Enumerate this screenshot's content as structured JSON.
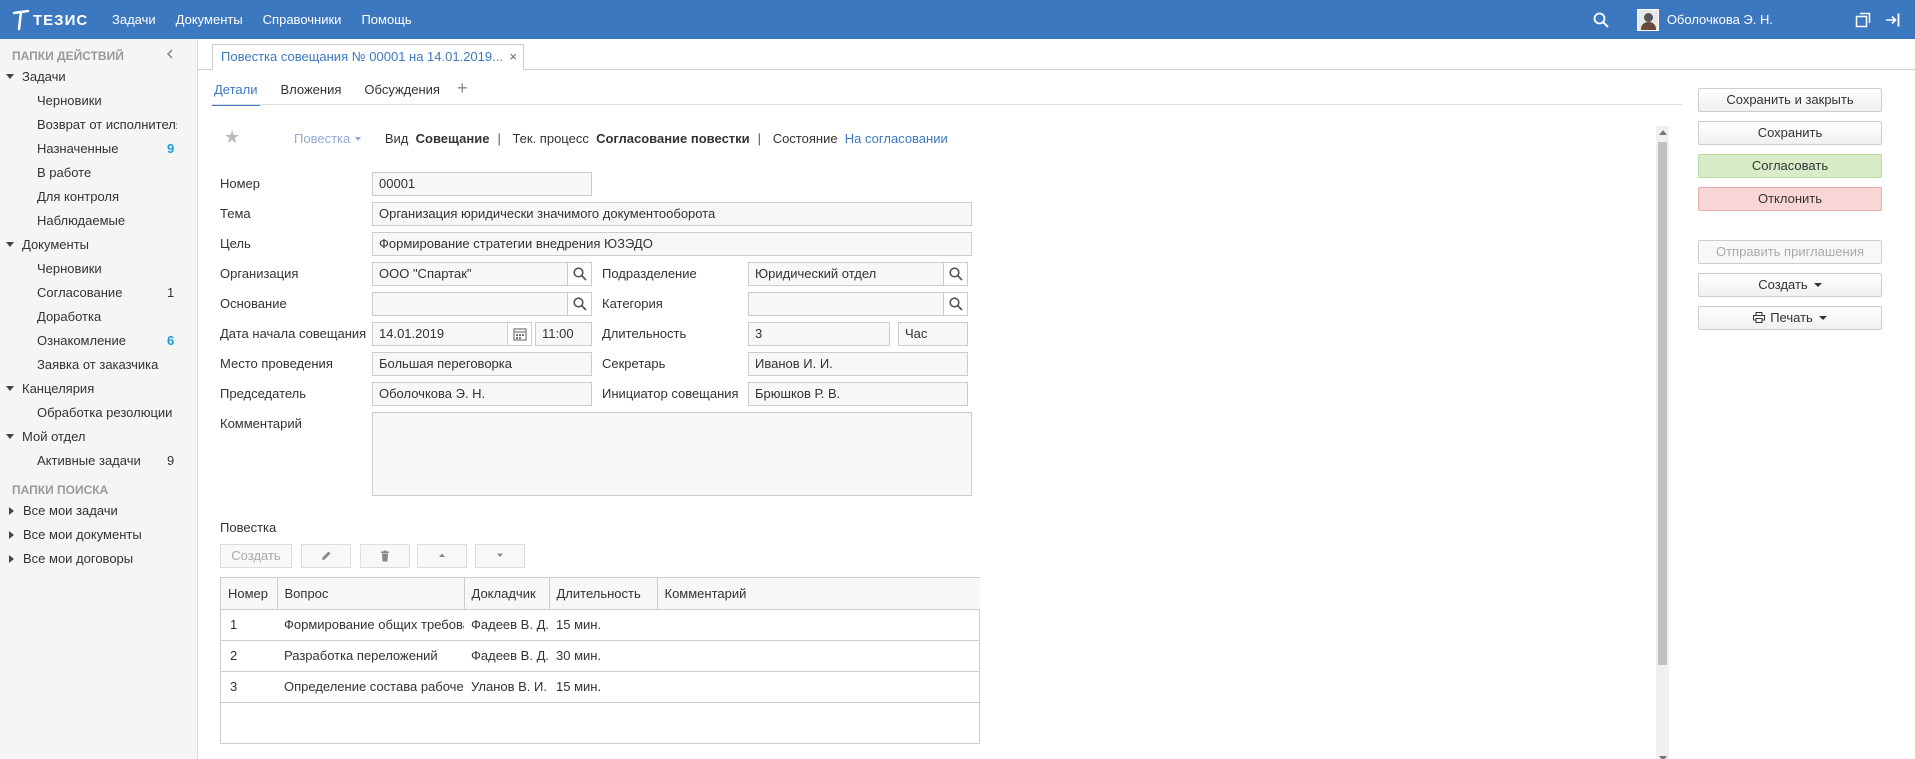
{
  "topbar": {
    "logo_text": "ТЕЗИС",
    "nav": [
      "Задачи",
      "Документы",
      "Справочники",
      "Помощь"
    ],
    "user_name": "Оболочкова Э. Н."
  },
  "sidebar": {
    "actions_title": "ПАПКИ ДЕЙСТВИЙ",
    "groups": [
      {
        "label": "Задачи",
        "children": [
          {
            "label": "Черновики",
            "count": ""
          },
          {
            "label": "Возврат от исполнителя",
            "count": ""
          },
          {
            "label": "Назначенные",
            "count": "9"
          },
          {
            "label": "В работе",
            "count": ""
          },
          {
            "label": "Для контроля",
            "count": ""
          },
          {
            "label": "Наблюдаемые",
            "count": ""
          }
        ]
      },
      {
        "label": "Документы",
        "children": [
          {
            "label": "Черновики",
            "count": ""
          },
          {
            "label": "Согласование",
            "count": "1"
          },
          {
            "label": "Доработка",
            "count": ""
          },
          {
            "label": "Ознакомление",
            "count": "6"
          },
          {
            "label": "Заявка от заказчика",
            "count": ""
          }
        ]
      },
      {
        "label": "Канцелярия",
        "children": [
          {
            "label": "Обработка резолюции",
            "count": ""
          }
        ]
      },
      {
        "label": "Мой отдел",
        "children": [
          {
            "label": "Активные задачи",
            "count": "9"
          }
        ]
      }
    ],
    "search_title": "ПАПКИ ПОИСКА",
    "search_items": [
      "Все мои задачи",
      "Все мои документы",
      "Все мои договоры"
    ]
  },
  "doc_tab": {
    "title": "Повестка совещания № 00001 на 14.01.2019...",
    "close": "×"
  },
  "subtabs": [
    "Детали",
    "Вложения",
    "Обсуждения"
  ],
  "header": {
    "type_dropdown": "Повестка",
    "kind_label": "Вид",
    "kind_value": "Совещание",
    "process_label": "Тек. процесс",
    "process_value": "Согласование повестки",
    "state_label": "Состояние",
    "state_value": "На согласовании"
  },
  "form": {
    "number_label": "Номер",
    "number_value": "00001",
    "topic_label": "Тема",
    "topic_value": "Организация юридически значимого документооборота",
    "goal_label": "Цель",
    "goal_value": "Формирование стратегии внедрения ЮЗЭДО",
    "org_label": "Организация",
    "org_value": "ООО \"Спартак\"",
    "dept_label": "Подразделение",
    "dept_value": "Юридический отдел",
    "basis_label": "Основание",
    "basis_value": "",
    "category_label": "Категория",
    "category_value": "",
    "date_label": "Дата начала совещания",
    "date_value": "14.01.2019",
    "time_value": "11:00",
    "duration_label": "Длительность",
    "duration_value": "3",
    "duration_unit": "Час",
    "place_label": "Место проведения",
    "place_value": "Большая переговорка",
    "secretary_label": "Секретарь",
    "secretary_value": "Иванов И. И.",
    "chair_label": "Председатель",
    "chair_value": "Оболочкова Э. Н.",
    "initiator_label": "Инициатор совещания",
    "initiator_value": "Брюшков Р. В.",
    "comment_label": "Комментарий",
    "comment_value": ""
  },
  "agenda": {
    "title": "Повестка",
    "create_label": "Создать",
    "columns": [
      "Номер",
      "Вопрос",
      "Докладчик",
      "Длительность",
      "Комментарий"
    ],
    "rows": [
      [
        "1",
        "Формирование общих требований",
        "Фадеев В. Д.",
        "15 мин.",
        ""
      ],
      [
        "2",
        "Разработка переложений",
        "Фадеев В. Д.",
        "30 мин.",
        ""
      ],
      [
        "3",
        "Определение состава рабочей группы",
        "Уланов В. И.",
        "15 мин.",
        ""
      ]
    ]
  },
  "actions": {
    "save_close": "Сохранить и закрыть",
    "save": "Сохранить",
    "approve": "Согласовать",
    "reject": "Отклонить",
    "send_invites": "Отправить приглашения",
    "create": "Создать",
    "print": "Печать"
  },
  "colors": {
    "topbar": "#3c78c0",
    "link": "#3c78c0",
    "count": "#1c9ad6",
    "approve": "#d9ecc8",
    "reject": "#f9d6d6"
  }
}
